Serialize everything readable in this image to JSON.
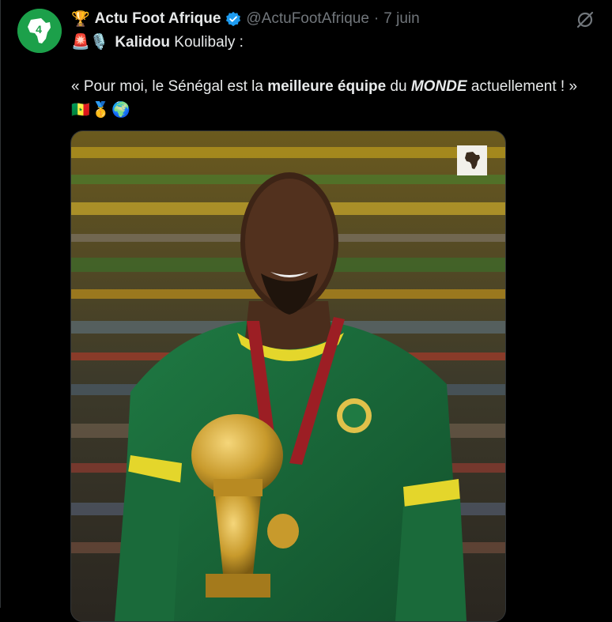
{
  "tweet": {
    "header_emoji": "🏆",
    "display_name": "Actu Foot Afrique",
    "handle": "@ActuFootAfrique",
    "separator": "·",
    "time": "7 juin",
    "line1": {
      "emojis": "🚨🎙️",
      "name_bold": "Kalidou",
      "name_rest": " Koulibaly :"
    },
    "quote": {
      "part1": "« Pour moi, le Sénégal est la ",
      "bold": "meilleure équipe",
      "part2": " du ",
      "bold_italic": "MONDE",
      "part3": " actuellement ! »"
    },
    "emoji_row": [
      "🇸🇳",
      "🥇",
      "🌍"
    ]
  },
  "colors": {
    "background": "#000000",
    "text": "#e7e9ea",
    "muted": "#71767b",
    "verified": "#1d9bf0",
    "avatar_green": "#1ca04a"
  },
  "icons": {
    "avatar": "africa-logo-icon",
    "verified": "verified-badge-icon",
    "grok": "grok-icon",
    "watermark": "africa-watermark-icon"
  }
}
